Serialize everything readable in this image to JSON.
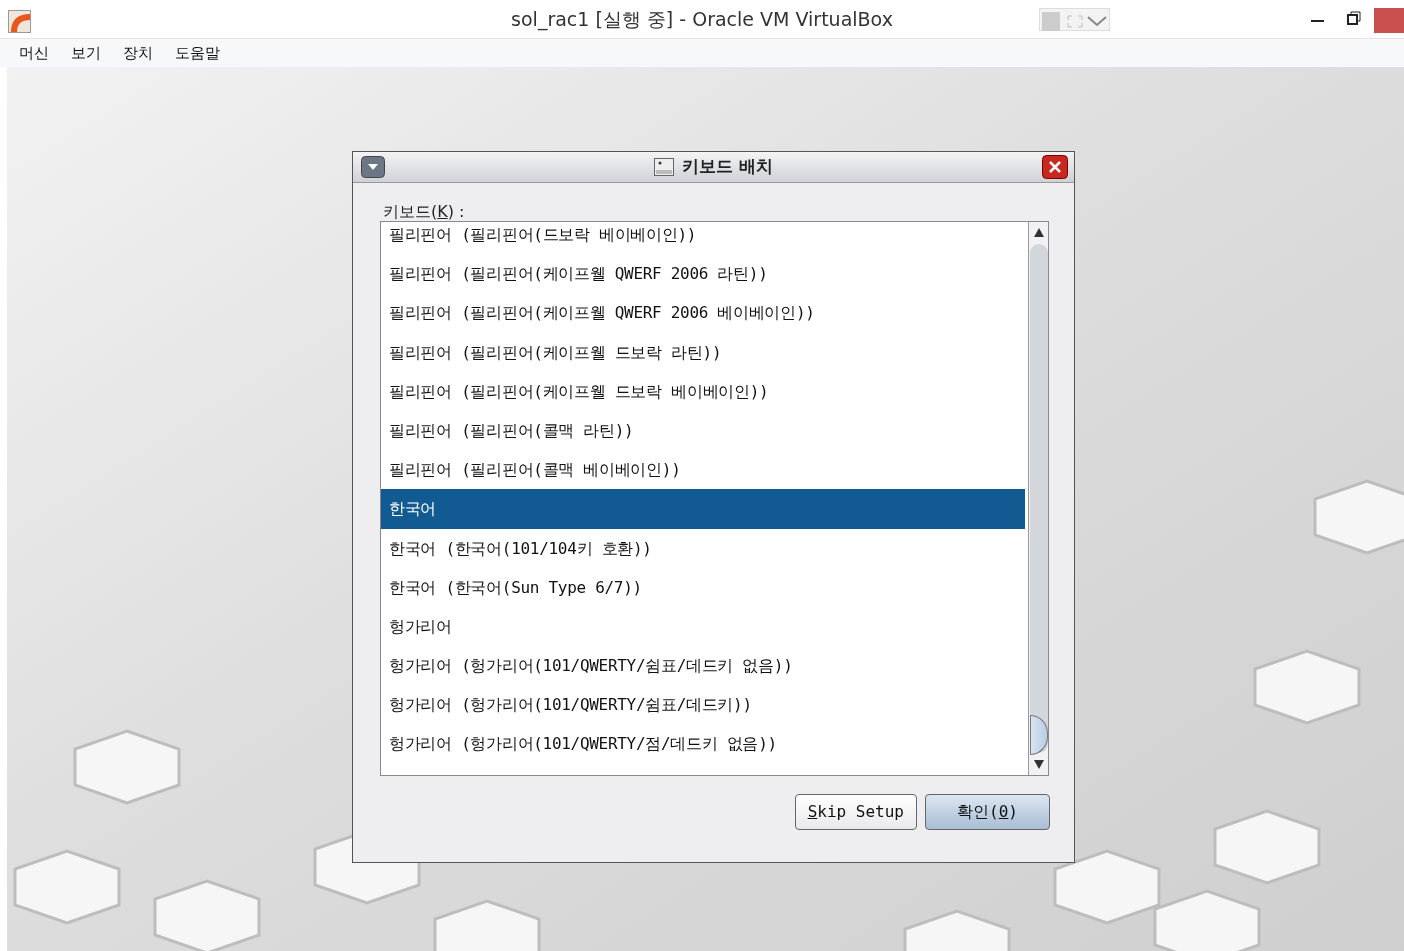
{
  "window": {
    "title": "sol_rac1 [실행 중] - Oracle VM VirtualBox"
  },
  "menu": [
    {
      "label": "머신"
    },
    {
      "label": "보기"
    },
    {
      "label": "장치"
    },
    {
      "label": "도움말"
    }
  ],
  "dialog": {
    "title": "키보드 배치",
    "field_label": {
      "before": "키보드(",
      "key": "K",
      "after": ") :"
    },
    "items": [
      {
        "label": "필리핀어 (필리핀어(드보락 베이베이인))",
        "selected": false
      },
      {
        "label": "필리핀어 (필리핀어(케이프웰 QWERF 2006 라틴))",
        "selected": false
      },
      {
        "label": "필리핀어 (필리핀어(케이프웰 QWERF 2006 베이베이인))",
        "selected": false
      },
      {
        "label": "필리핀어 (필리핀어(케이프웰 드보락 라틴))",
        "selected": false
      },
      {
        "label": "필리핀어 (필리핀어(케이프웰 드보락 베이베이인))",
        "selected": false
      },
      {
        "label": "필리핀어 (필리핀어(콜맥 라틴))",
        "selected": false
      },
      {
        "label": "필리핀어 (필리핀어(콜맥 베이베이인))",
        "selected": false
      },
      {
        "label": "한국어",
        "selected": true
      },
      {
        "label": "한국어 (한국어(101/104키 호환))",
        "selected": false
      },
      {
        "label": "한국어 (한국어(Sun Type 6/7))",
        "selected": false
      },
      {
        "label": "헝가리어",
        "selected": false
      },
      {
        "label": "헝가리어 (헝가리어(101/QWERTY/쉼표/데드키 없음))",
        "selected": false
      },
      {
        "label": "헝가리어 (헝가리어(101/QWERTY/쉼표/데드키))",
        "selected": false
      },
      {
        "label": "헝가리어 (헝가리어(101/QWERTY/점/데드키 없음))",
        "selected": false
      }
    ],
    "buttons": [
      {
        "key": "S",
        "after": "kip Setup",
        "kind": "plain"
      },
      {
        "before": "확인(",
        "key": "0",
        "after": ")",
        "kind": "default"
      }
    ]
  }
}
